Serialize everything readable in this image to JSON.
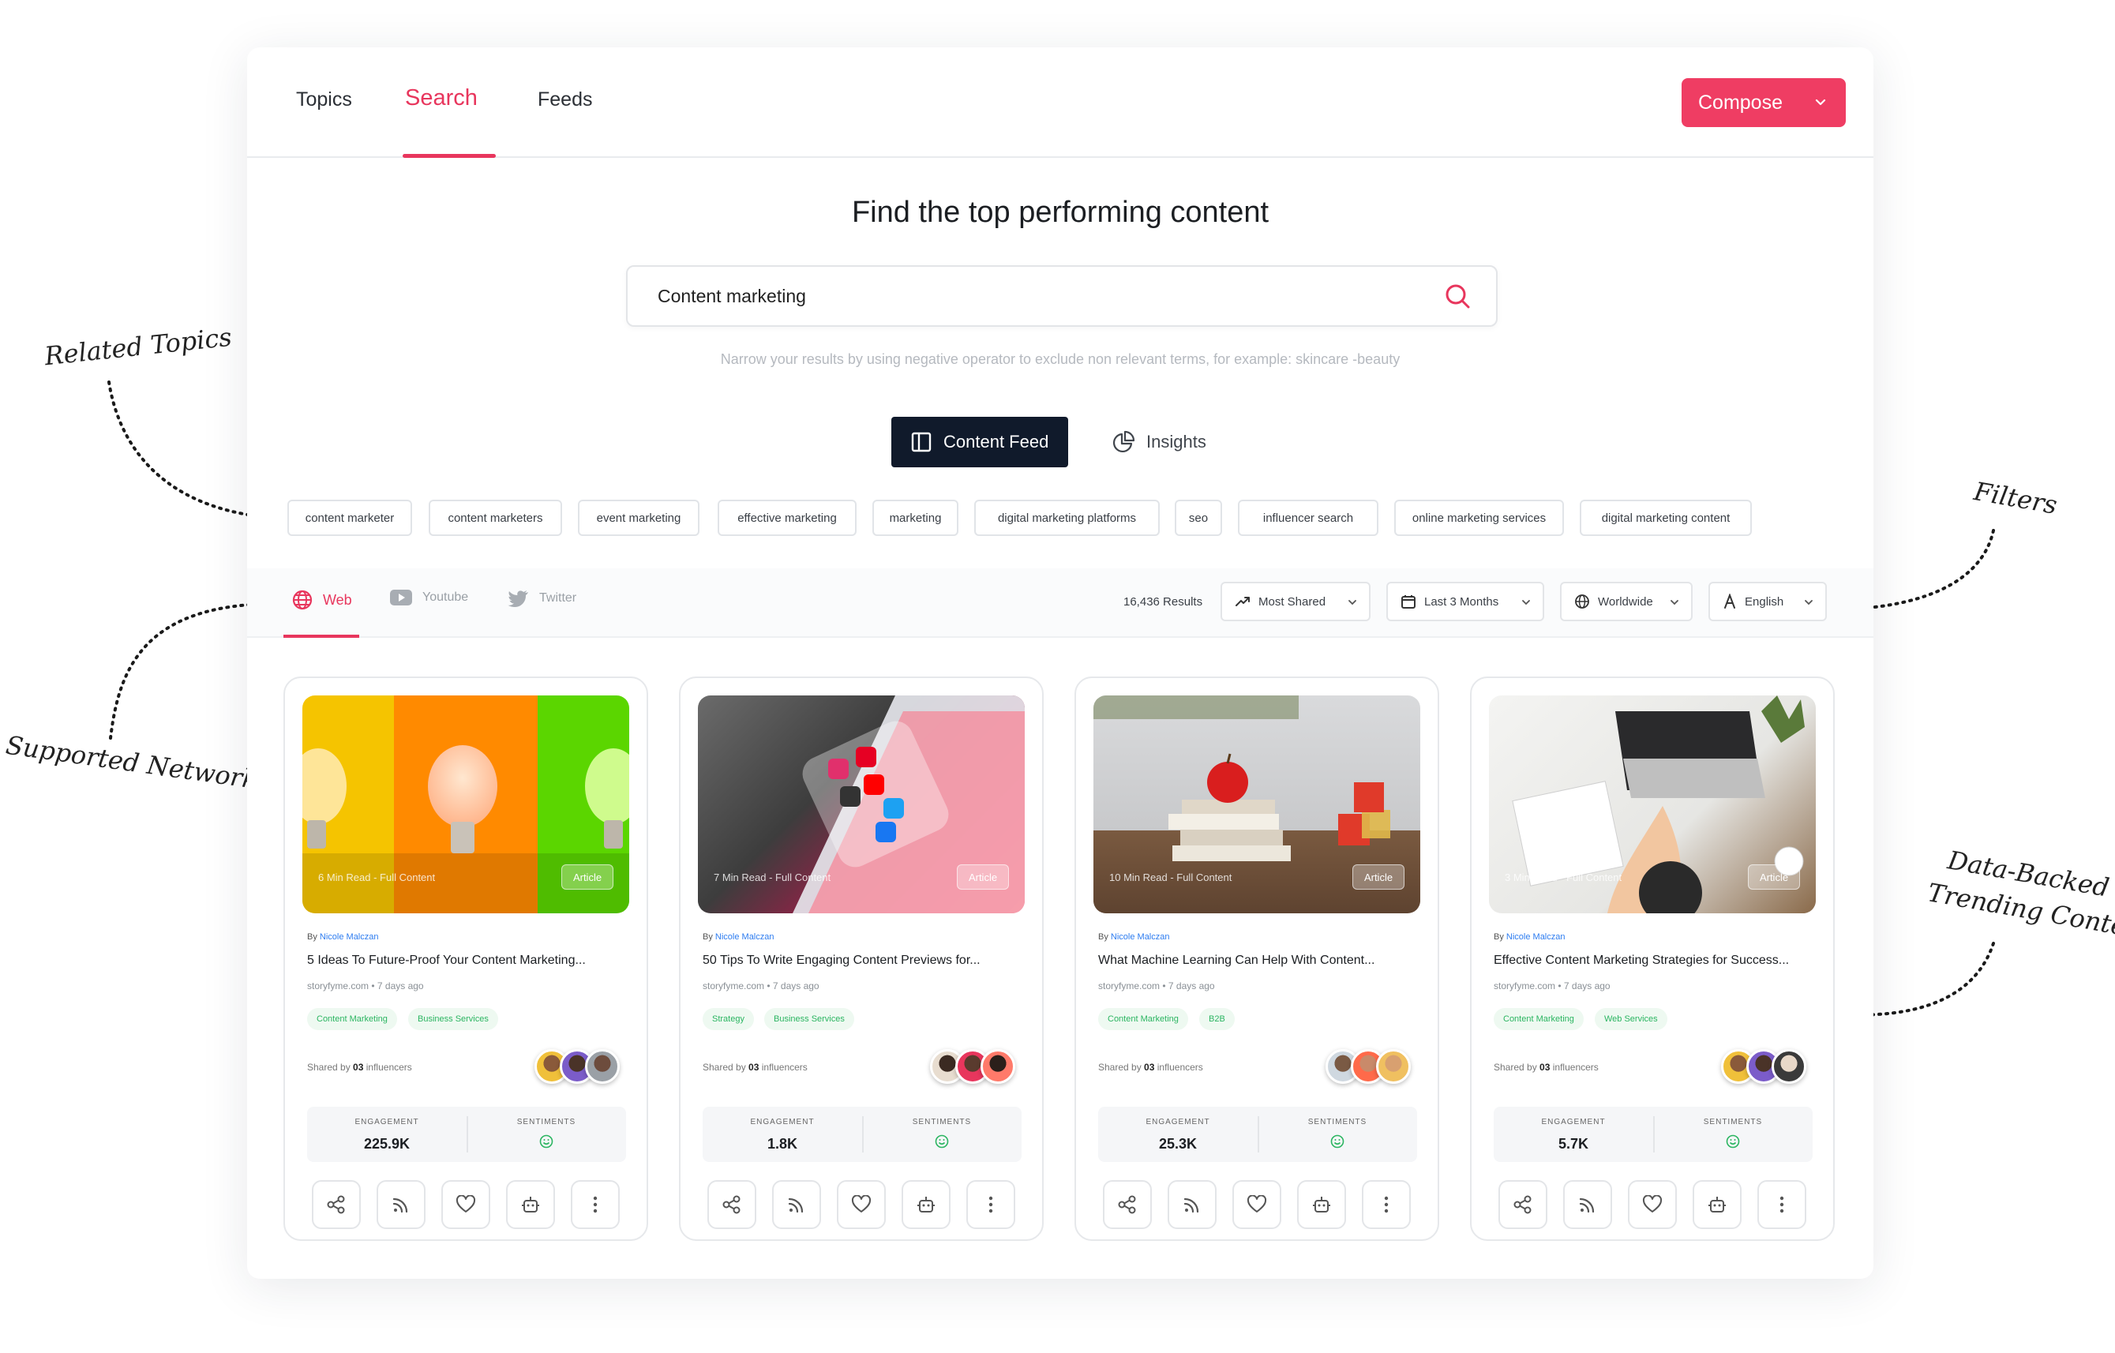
{
  "annotations": {
    "related_topics": "Related Topics",
    "supported_networks": "Supported Networks",
    "filters": "Filters",
    "data_backed_1": "Data-Backed",
    "data_backed_2": "Trending Content"
  },
  "nav": {
    "tabs": [
      "Topics",
      "Search",
      "Feeds"
    ],
    "active": "Search",
    "compose_label": "Compose"
  },
  "hero": {
    "headline": "Find the top performing content",
    "search_value": "Content marketing",
    "hint": "Narrow your results by using negative operator to exclude non relevant terms, for example: skincare -beauty"
  },
  "view_toggle": {
    "content_feed": "Content Feed",
    "insights": "Insights"
  },
  "related_topics": [
    "content marketer",
    "content marketers",
    "event marketing",
    "effective marketing",
    "marketing",
    "digital marketing platforms",
    "seo",
    "influencer search",
    "online marketing services",
    "digital marketing content"
  ],
  "networks": {
    "web": "Web",
    "youtube": "Youtube",
    "twitter": "Twitter"
  },
  "filters": {
    "results": "16,436 Results",
    "sort": "Most Shared",
    "period": "Last 3 Months",
    "region": "Worldwide",
    "language": "English"
  },
  "card_common": {
    "by_prefix": "By",
    "shared_prefix": "Shared by",
    "shared_count": "03",
    "shared_suffix": "influencers",
    "engagement_label": "ENGAGEMENT",
    "sentiments_label": "SENTIMENTS",
    "type": "Article"
  },
  "cards": [
    {
      "read": "6 Min Read - Full Content",
      "author": "Nicole Malczan",
      "title": "5 Ideas To Future-Proof Your Content Marketing...",
      "source": "storyfyme.com • 7 days ago",
      "tags": [
        "Content Marketing",
        "Business Services"
      ],
      "engagement": "225.9K"
    },
    {
      "read": "7 Min Read - Full Content",
      "author": "Nicole Malczan",
      "title": "50 Tips To Write Engaging Content Previews for...",
      "source": "storyfyme.com • 7 days ago",
      "tags": [
        "Strategy",
        "Business Services"
      ],
      "engagement": "1.8K"
    },
    {
      "read": "10 Min Read - Full Content",
      "author": "Nicole Malczan",
      "title": "What Machine Learning Can Help With Content...",
      "source": "storyfyme.com • 7 days ago",
      "tags": [
        "Content Marketing",
        "B2B"
      ],
      "engagement": "25.3K"
    },
    {
      "read": "3 Min Read - Full Content",
      "author": "Nicole Malczan",
      "title": "Effective Content Marketing Strategies for Success...",
      "source": "storyfyme.com • 7 days ago",
      "tags": [
        "Content Marketing",
        "Web Services"
      ],
      "engagement": "5.7K"
    }
  ],
  "colors": {
    "accent": "#e8365d",
    "dark": "#101a2b",
    "tag_green": "#2bb561"
  },
  "icons": [
    "search-icon",
    "chevron-down-icon",
    "layout-icon",
    "pie-chart-icon",
    "globe-icon",
    "youtube-icon",
    "twitter-icon",
    "trend-icon",
    "calendar-icon",
    "font-icon",
    "share-icon",
    "rss-icon",
    "heart-icon",
    "robot-icon",
    "more-icon",
    "smile-icon"
  ]
}
